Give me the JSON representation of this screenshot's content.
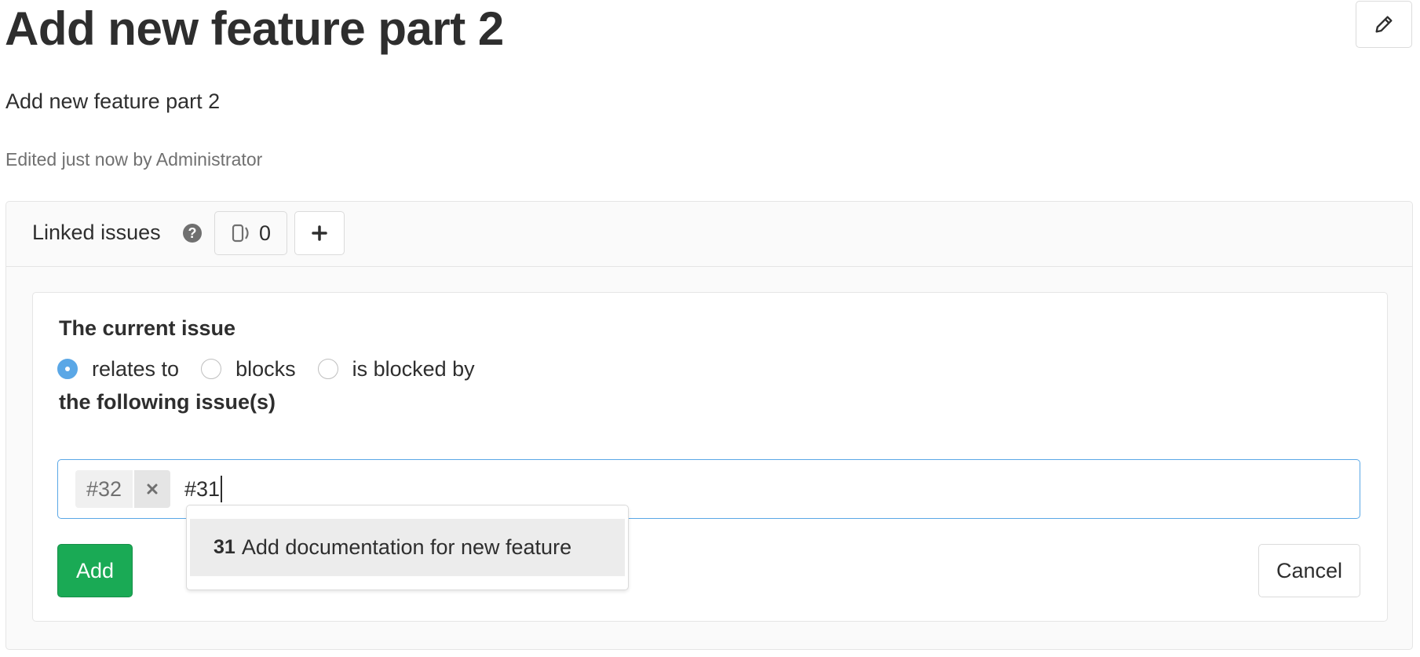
{
  "issue": {
    "title": "Add new feature part 2",
    "description": "Add new feature part 2",
    "edited_text": "Edited just now by Administrator",
    "edit_icon": "pencil-icon"
  },
  "linked_issues": {
    "title": "Linked issues",
    "help_icon": "question-circle-icon",
    "count_icon": "issues-icon",
    "count": "0",
    "add_icon": "plus-icon"
  },
  "form": {
    "current_issue_label": "The current issue",
    "relation_options": [
      {
        "label": "relates to",
        "checked": true
      },
      {
        "label": "blocks",
        "checked": false
      },
      {
        "label": "is blocked by",
        "checked": false
      }
    ],
    "following_label": "the following issue(s)",
    "tokens": [
      {
        "label": "#32",
        "remove_icon": "close-icon"
      }
    ],
    "typed_value": "#31",
    "add_button": "Add",
    "cancel_button": "Cancel"
  },
  "autocomplete": {
    "items": [
      {
        "ref": "31",
        "title": "Add documentation for new feature"
      }
    ]
  },
  "colors": {
    "primary_blue": "#5aa7e6",
    "success_green": "#1aaa55",
    "text": "#2e2e2e",
    "muted": "#707070"
  }
}
